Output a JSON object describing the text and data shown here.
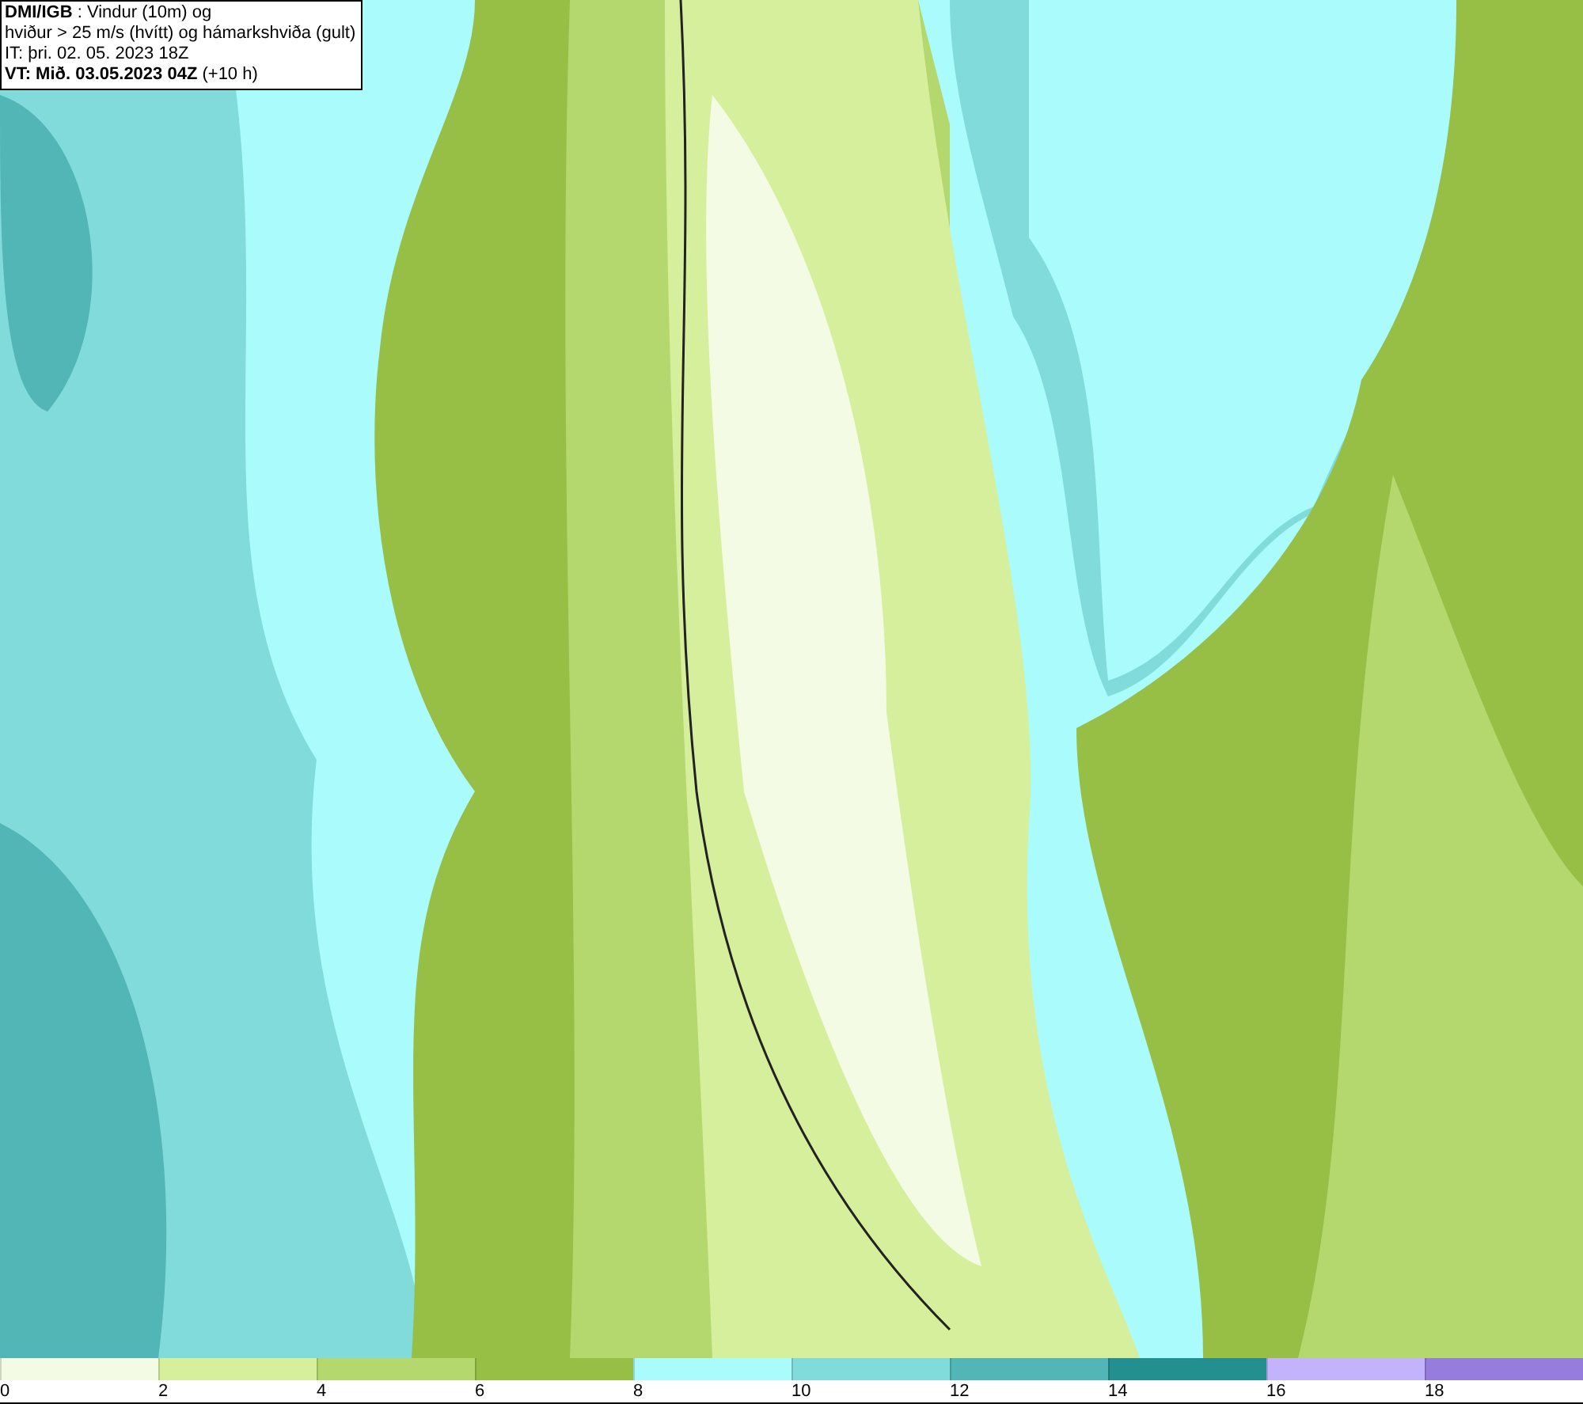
{
  "title_box": {
    "lines": [
      "**DMI/IGB** : Vindur (10m) og",
      "hviður > 25 m/s (hvítt) og hámarkshviða (gult)",
      "IT: þri. 02. 05. 2023 18Z",
      "**VT: Mið. 03.05.2023 04Z** (+10 h)"
    ]
  },
  "legend": {
    "segments": [
      {
        "label": "0",
        "color": "#f4fbe4"
      },
      {
        "label": "2",
        "color": "#d6ef9c"
      },
      {
        "label": "4",
        "color": "#b5d86e"
      },
      {
        "label": "6",
        "color": "#97bf45"
      },
      {
        "label": "8",
        "color": "#aafcfc"
      },
      {
        "label": "10",
        "color": "#82dbdb"
      },
      {
        "label": "12",
        "color": "#52b6b6"
      },
      {
        "label": "14",
        "color": "#248f8f"
      },
      {
        "label": "16",
        "color": "#c3b2fc"
      },
      {
        "label": "18",
        "color": "#967cdc"
      }
    ]
  }
}
